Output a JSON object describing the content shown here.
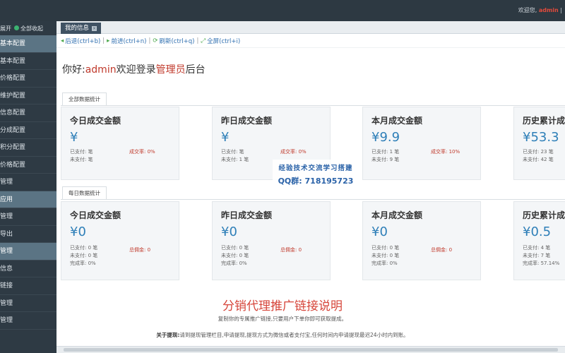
{
  "topbar": {
    "greeting": "欢迎您,",
    "user": "admin",
    "suffix": "|"
  },
  "sidebar": {
    "expand": "展开",
    "collapse_all": "全部收起",
    "items": [
      "基本配置",
      "基本配置",
      "价格配置",
      "维护配置",
      "信息配置",
      "分成配置",
      "积分配置",
      "价格配置",
      "管理",
      "应用",
      "管理",
      "导出",
      "管理",
      "信息",
      "链接",
      "管理",
      "管理"
    ]
  },
  "tab": {
    "label": "我的信息"
  },
  "toolbar": {
    "back": "后退(ctrl+b)",
    "forward": "前进(ctrl+n)",
    "refresh": "刷新(ctrl+q)",
    "fullscreen": "全屏(ctrl+i)"
  },
  "welcome": {
    "prefix": "你好:",
    "user": "admin",
    "mid": "欢迎登录",
    "role": "管理员",
    "suffix": "后台"
  },
  "all_stats": {
    "tab": "全部数据统计",
    "cards": [
      {
        "title": "今日成交金额",
        "amount": "¥",
        "paid": "已支付: 笔",
        "unpaid": "未支付: 笔",
        "rate": "成交率: 0%"
      },
      {
        "title": "昨日成交金额",
        "amount": "¥",
        "paid": "已支付: 笔",
        "unpaid": "未支付: 1 笔",
        "rate": "成交率: 0%"
      },
      {
        "title": "本月成交金额",
        "amount": "¥9.9",
        "paid": "已支付: 1 笔",
        "unpaid": "未支付: 9 笔",
        "rate": "成交率: 10%"
      },
      {
        "title": "历史累计成",
        "amount": "¥53.3",
        "paid": "已支付: 23 笔",
        "unpaid": "未支付: 42 笔",
        "rate": ""
      }
    ]
  },
  "daily_stats": {
    "tab": "每日数据统计",
    "cards": [
      {
        "title": "今日成交金额",
        "amount": "¥0",
        "paid": "已支付: 0 笔",
        "unpaid": "未支付: 0 笔",
        "done": "完成率: 0%",
        "commission": "总佣金: 0"
      },
      {
        "title": "昨日成交金额",
        "amount": "¥0",
        "paid": "已支付: 0 笔",
        "unpaid": "未支付: 0 笔",
        "done": "完成率: 0%",
        "commission": "总佣金: 0"
      },
      {
        "title": "本月成交金额",
        "amount": "¥0",
        "paid": "已支付: 0 笔",
        "unpaid": "未支付: 0 笔",
        "done": "完成率: 0%",
        "commission": "总佣金: 0"
      },
      {
        "title": "历史累计成",
        "amount": "¥0.5",
        "paid": "已支付: 4 笔",
        "unpaid": "未支付: 7 笔",
        "done": "完成率: 57.14%",
        "commission": ""
      }
    ]
  },
  "watermark": {
    "line1": "经验技术交流学习搭建",
    "line2": "QQ群: 718195723"
  },
  "promo": {
    "title": "分销代理推广链接说明",
    "subtitle": "复制你的专属推广链接,只要用户下单你即可获取提成。",
    "note_label": "关于提现:",
    "note": "请到提现管理栏目,申请提现,提现方式为微信或者支付宝,任何时间内申请提现最迟24小时内到账。"
  },
  "colors": {
    "accent": "#2e7fb8",
    "danger": "#c0392b",
    "sidebar": "#2e3a44"
  }
}
